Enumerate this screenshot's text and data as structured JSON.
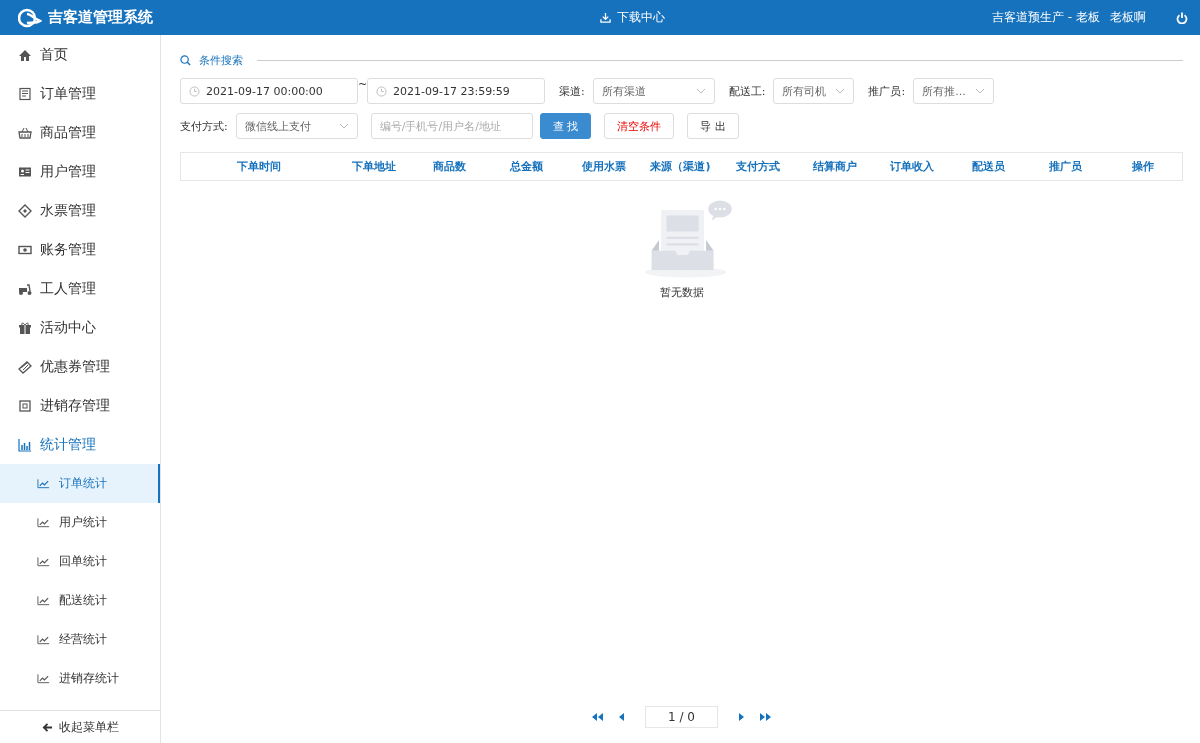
{
  "header": {
    "title": "吉客道管理系统",
    "download": "下载中心",
    "org": "吉客道预生产 - 老板",
    "user": "老板啊"
  },
  "sidebar": {
    "items": [
      {
        "label": "首页",
        "kind": "home",
        "selected": false
      },
      {
        "label": "订单管理",
        "kind": "doc",
        "selected": false
      },
      {
        "label": "商品管理",
        "kind": "basket",
        "selected": false
      },
      {
        "label": "用户管理",
        "kind": "card",
        "selected": false
      },
      {
        "label": "水票管理",
        "kind": "ticket",
        "selected": false
      },
      {
        "label": "账务管理",
        "kind": "money",
        "selected": false
      },
      {
        "label": "工人管理",
        "kind": "scooter",
        "selected": false
      },
      {
        "label": "活动中心",
        "kind": "gift",
        "selected": false
      },
      {
        "label": "优惠券管理",
        "kind": "coupon",
        "selected": false
      },
      {
        "label": "进销存管理",
        "kind": "box",
        "selected": false
      },
      {
        "label": "统计管理",
        "kind": "chart",
        "selected": true,
        "expanded": true,
        "children": [
          {
            "label": "订单统计",
            "selected": true
          },
          {
            "label": "用户统计",
            "selected": false
          },
          {
            "label": "回单统计",
            "selected": false
          },
          {
            "label": "配送统计",
            "selected": false
          },
          {
            "label": "经营统计",
            "selected": false
          },
          {
            "label": "进销存统计",
            "selected": false
          }
        ]
      }
    ],
    "collapse": "收起菜单栏"
  },
  "search": {
    "title": "条件搜索",
    "date_from": "2021-09-17 00:00:00",
    "separator": "~",
    "date_to": "2021-09-17 23:59:59",
    "channel": {
      "label": "渠道:",
      "value": "所有渠道"
    },
    "courier": {
      "label": "配送工:",
      "value": "所有司机"
    },
    "promoter": {
      "label": "推广员:",
      "value": "所有推..."
    },
    "payment": {
      "label": "支付方式:",
      "value": "微信线上支付"
    },
    "keyword": {
      "placeholder": "编号/手机号/用户名/地址"
    },
    "buttons": [
      {
        "label": "查 找",
        "kind": "primary"
      },
      {
        "label": "清空条件",
        "kind": "danger"
      },
      {
        "label": "导 出",
        "kind": "plain"
      }
    ]
  },
  "table": {
    "columns": [
      "下单时间",
      "下单地址",
      "商品数",
      "总金额",
      "使用水票",
      "来源（渠道)",
      "支付方式",
      "结算商户",
      "订单收入",
      "配送员",
      "推广员",
      "操作"
    ],
    "empty": "暂无数据"
  },
  "pagination": {
    "page": "1 / 0"
  }
}
